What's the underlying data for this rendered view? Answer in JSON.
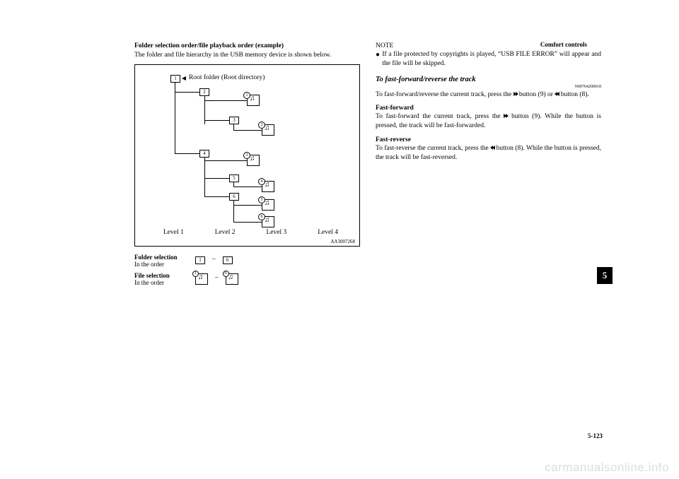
{
  "header": "Comfort controls",
  "pageNumber": "5-123",
  "tabNumber": "5",
  "watermark": "carmanualsonline.info",
  "left": {
    "title": "Folder selection order/file playback order (example)",
    "intro": "The folder and file hierarchy in the USB memory device is shown below.",
    "diagram": {
      "rootLabel": "Root folder (Root directory)",
      "levels": [
        "Level 1",
        "Level 2",
        "Level 3",
        "Level 4"
      ],
      "code": "AA3007268",
      "folders": [
        "1",
        "2",
        "3",
        "4",
        "5",
        "6"
      ],
      "files": [
        "1",
        "2",
        "3",
        "4",
        "5",
        "6"
      ]
    },
    "legend": {
      "folderTitle": "Folder selection",
      "folderSub": "In the order",
      "folderFrom": "1",
      "folderTo": "6",
      "fileTitle": "File selection",
      "fileSub": "In the order",
      "fileFrom": "1",
      "fileTo": "6"
    }
  },
  "right": {
    "noteLabel": "NOTE",
    "noteBullet": "If a file protected by copyrights is played, “USB FILE ERROR” will appear and the file will be skipped.",
    "subheading": "To fast-forward/reverse the track",
    "refCode": "N00764200018",
    "para1a": "To fast-forward/reverse the current track, press the ",
    "para1b": " button (9) or ",
    "para1c": " button (8).",
    "ffTitle": "Fast-forward",
    "ffBodyA": "To fast-forward the current track, press the ",
    "ffBodyB": " button (9). While the button is pressed, the track will be fast-forwarded.",
    "frTitle": "Fast-reverse",
    "frBodyA": "To fast-reverse the current track, press the ",
    "frBodyB": " button (8). While the button is pressed, the track will be fast-reversed."
  }
}
